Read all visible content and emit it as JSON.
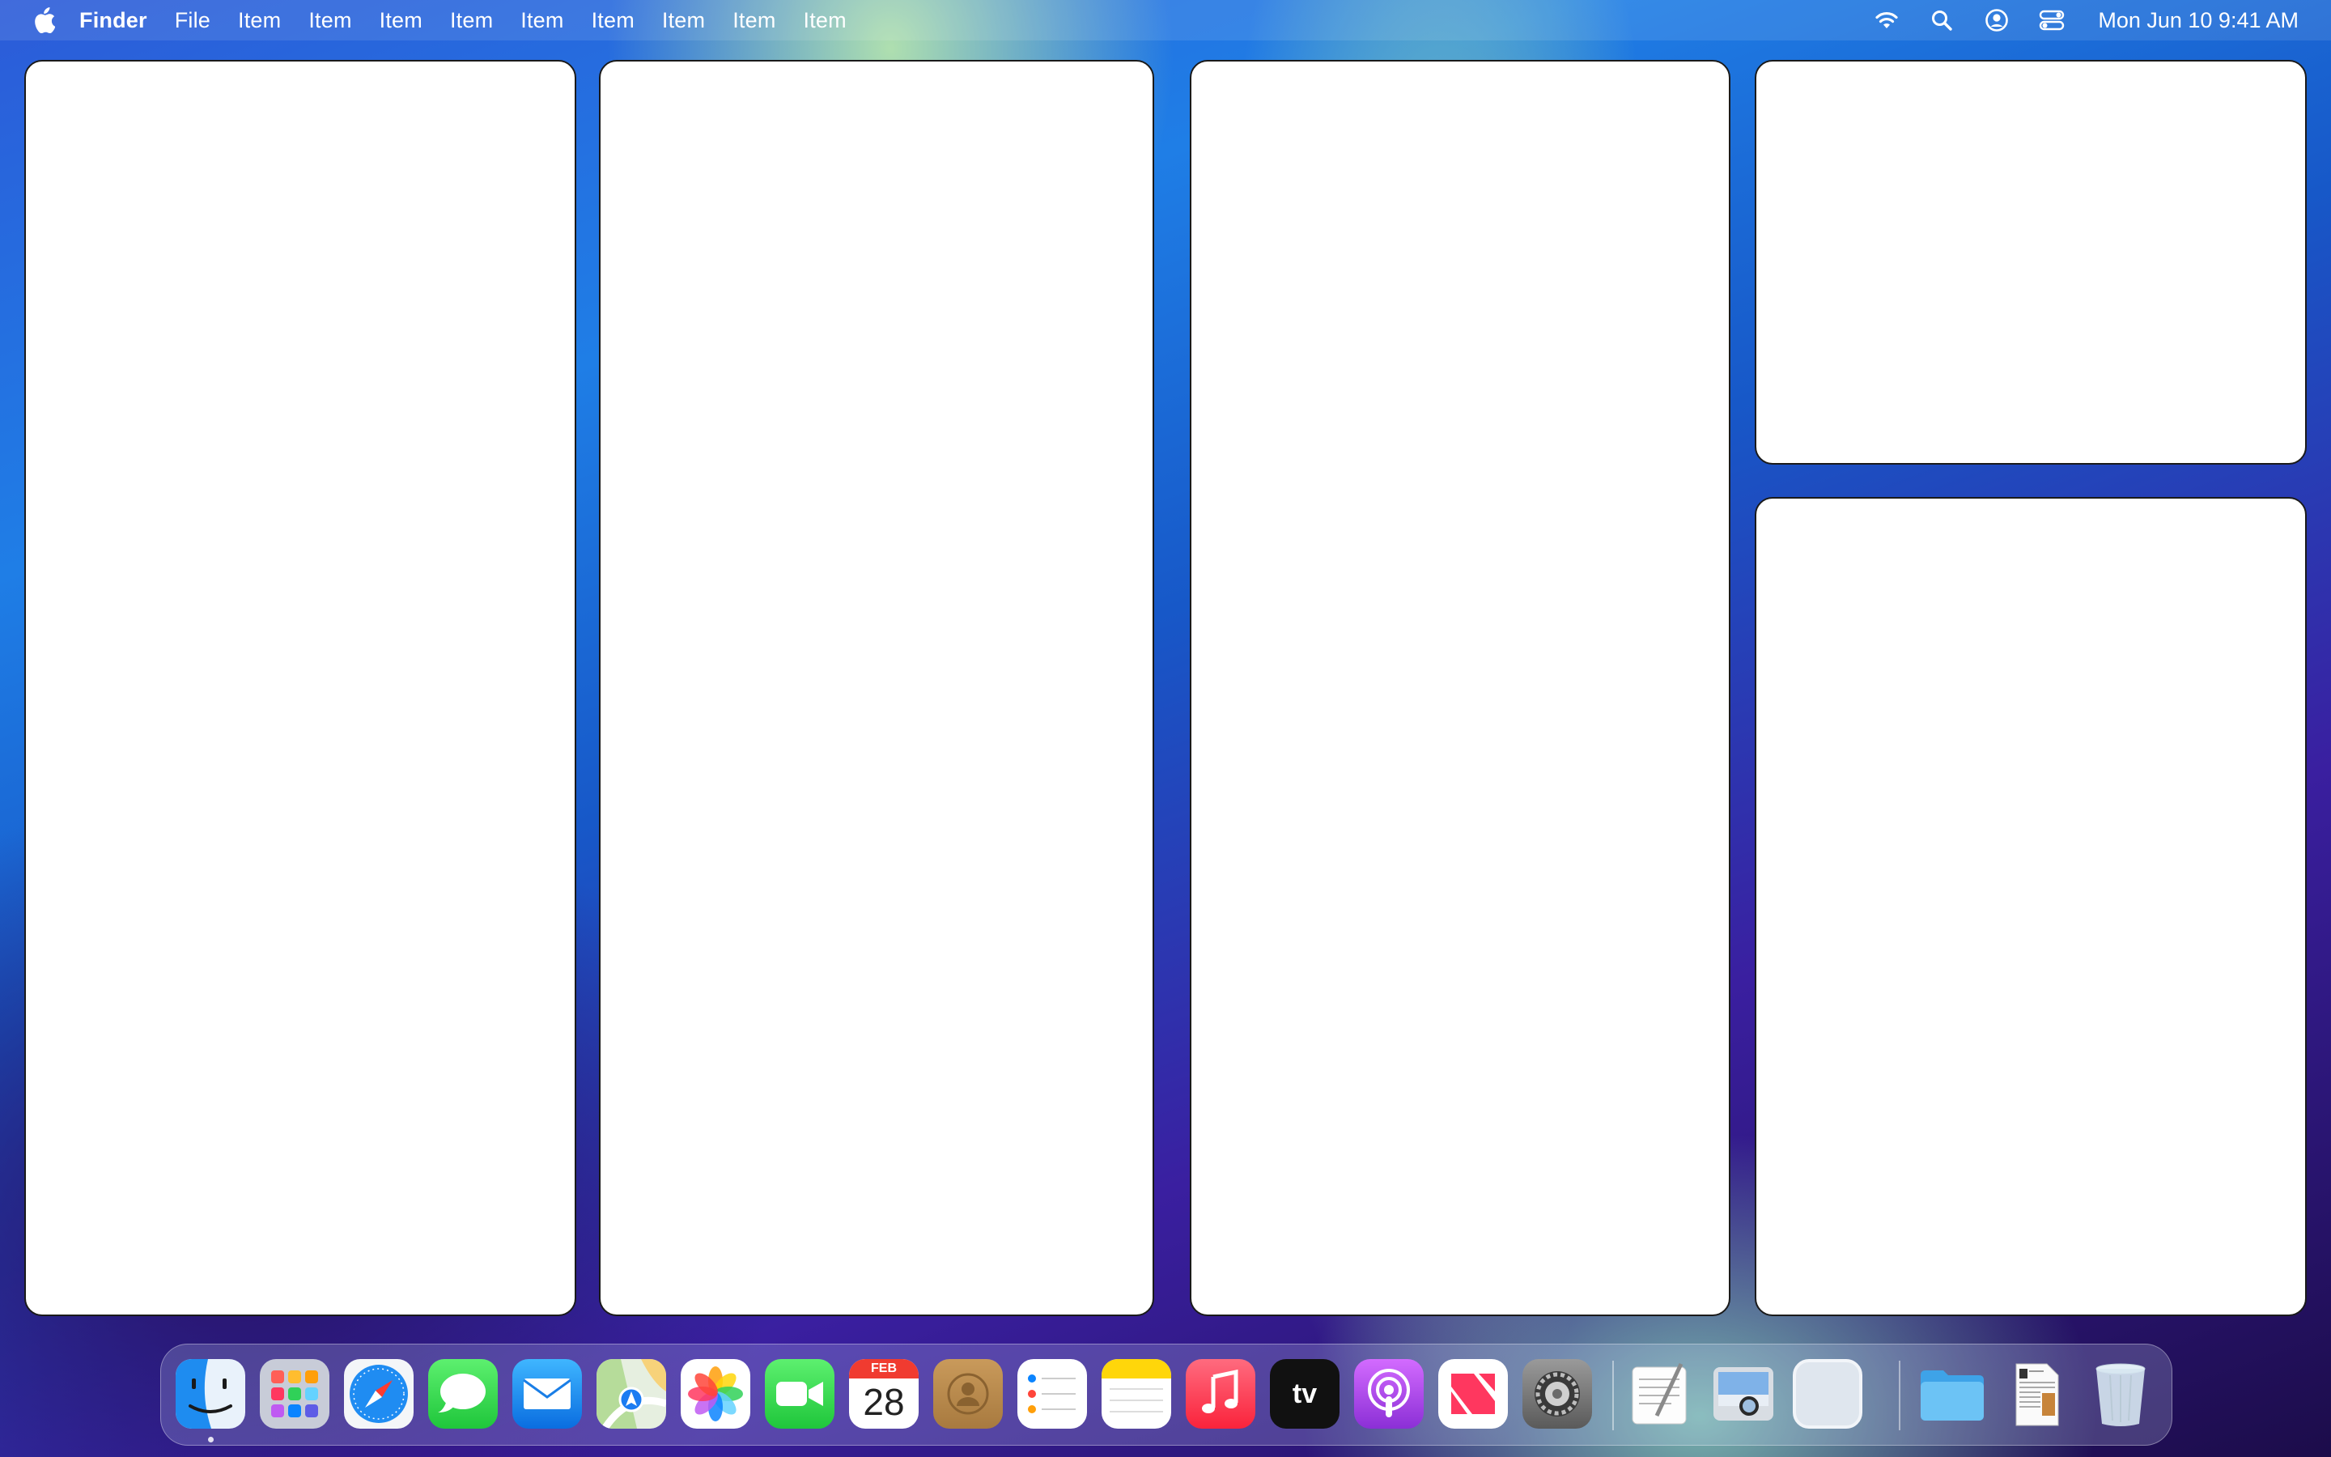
{
  "menubar": {
    "app_name": "Finder",
    "items": [
      "File",
      "Item",
      "Item",
      "Item",
      "Item",
      "Item",
      "Item",
      "Item",
      "Item",
      "Item"
    ],
    "status_icons": [
      "wifi-icon",
      "spotlight-search-icon",
      "user-account-icon",
      "control-center-icon"
    ],
    "clock": "Mon Jun 10  9:41 AM"
  },
  "dock": {
    "apps": [
      {
        "name": "Finder",
        "icon": "finder-icon",
        "running": true
      },
      {
        "name": "Launchpad",
        "icon": "launchpad-icon"
      },
      {
        "name": "Safari",
        "icon": "safari-icon"
      },
      {
        "name": "Messages",
        "icon": "messages-icon"
      },
      {
        "name": "Mail",
        "icon": "mail-icon"
      },
      {
        "name": "Maps",
        "icon": "maps-icon"
      },
      {
        "name": "Photos",
        "icon": "photos-icon"
      },
      {
        "name": "FaceTime",
        "icon": "facetime-icon"
      },
      {
        "name": "Calendar",
        "icon": "calendar-icon"
      },
      {
        "name": "Contacts",
        "icon": "contacts-icon"
      },
      {
        "name": "Reminders",
        "icon": "reminders-icon"
      },
      {
        "name": "Notes",
        "icon": "notes-icon"
      },
      {
        "name": "Music",
        "icon": "music-icon"
      },
      {
        "name": "TV",
        "icon": "apple-tv-icon"
      },
      {
        "name": "Podcasts",
        "icon": "podcasts-icon"
      },
      {
        "name": "News",
        "icon": "news-icon"
      },
      {
        "name": "System Settings",
        "icon": "system-settings-icon"
      },
      {
        "name": "TextEdit",
        "icon": "textedit-icon"
      },
      {
        "name": "Preview",
        "icon": "preview-icon"
      },
      {
        "name": "Blank App",
        "icon": "blank-app-icon"
      },
      {
        "name": "Folder",
        "icon": "folder-icon"
      },
      {
        "name": "Document",
        "icon": "document-icon"
      },
      {
        "name": "Trash",
        "icon": "trash-icon"
      }
    ],
    "calendar_month": "FEB",
    "calendar_day": "28",
    "tv_label": "tv"
  },
  "colors": {
    "window_bg": "#ffffff",
    "window_border": "#1a1a1a",
    "wallpaper_blue": "#1f7ee6",
    "wallpaper_green": "#aae6aa",
    "wallpaper_purple": "#3a1fa0"
  }
}
